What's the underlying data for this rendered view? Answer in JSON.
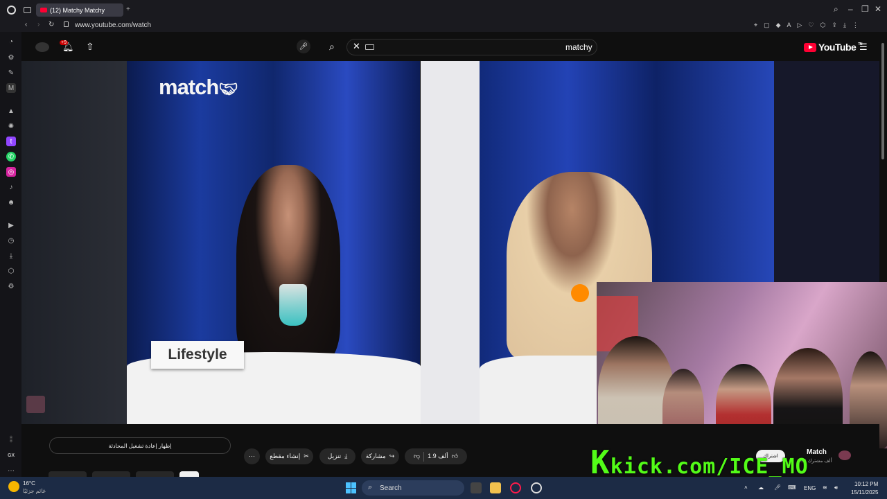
{
  "browser": {
    "tab_title": "(12) Matchy Matchy",
    "url": "www.youtube.com/watch"
  },
  "youtube": {
    "notification_badge": "+9",
    "search_query": "matchy",
    "logo_text": "YouTube",
    "logo_sup": "TN"
  },
  "video": {
    "brand_logo": "match",
    "sign_text": "Lifestyle"
  },
  "actions": {
    "like_count": "1.9 ألف",
    "share_label": "مشاركة",
    "download_label": "تنزيل",
    "clip_label": "إنشاء مقطع",
    "replay_label": "إظهار إعادة تشغيل المحادثة"
  },
  "channel": {
    "name": "Match",
    "subscribers": "395 ألف مشترك",
    "subscribe_label": "اشتراك"
  },
  "overlay": {
    "kick_text": "kick.com/ICE_MO",
    "kick_letter": "K"
  },
  "taskbar": {
    "weather_temp": "16°C",
    "weather_desc": "غائم جزئيًا",
    "search_label": "Search",
    "lang": "ENG",
    "time": "10:12 PM",
    "date": "15/11/2025"
  },
  "colors": {
    "kick_green": "#53fc18",
    "yt_red": "#ff0033"
  }
}
